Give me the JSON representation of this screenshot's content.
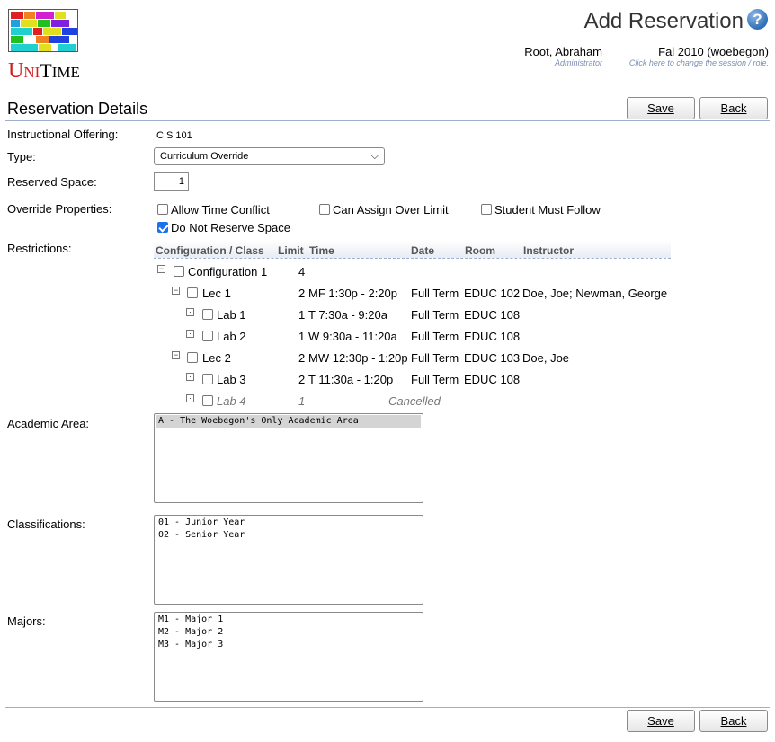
{
  "header": {
    "logo_text": "UniTime",
    "page_title": "Add Reservation",
    "help_icon": "help-icon",
    "user_name": "Root, Abraham",
    "user_role": "Administrator",
    "session_name": "Fal 2010 (woebegon)",
    "session_hint": "Click here to change the session / role."
  },
  "section": {
    "title": "Reservation Details",
    "save_label": "Save",
    "back_label": "Back"
  },
  "form": {
    "offering_label": "Instructional Offering:",
    "offering_value": "C S 101",
    "type_label": "Type:",
    "type_value": "Curriculum Override",
    "reserved_label": "Reserved Space:",
    "reserved_value": "1",
    "override_label": "Override Properties:",
    "override_options": [
      {
        "label": "Allow Time Conflict",
        "checked": false
      },
      {
        "label": "Can Assign Over Limit",
        "checked": false
      },
      {
        "label": "Student Must Follow",
        "checked": false
      },
      {
        "label": "Do Not Reserve Space",
        "checked": true
      }
    ],
    "restrictions_label": "Restrictions:",
    "academic_area_label": "Academic Area:",
    "classifications_label": "Classifications:",
    "majors_label": "Majors:"
  },
  "restrictions": {
    "columns": [
      "Configuration / Class",
      "Limit",
      "Time",
      "Date",
      "Room",
      "Instructor"
    ],
    "rows": [
      {
        "name": "Configuration 1",
        "limit": "4",
        "time": "",
        "date": "",
        "room": "",
        "instructor": ""
      },
      {
        "name": "Lec 1",
        "limit": "2",
        "time": "MF 1:30p - 2:20p",
        "date": "Full Term",
        "room": "EDUC 102",
        "instructor": "Doe, Joe; Newman, George"
      },
      {
        "name": "Lab 1",
        "limit": "1",
        "time": "T 7:30a - 9:20a",
        "date": "Full Term",
        "room": "EDUC 108",
        "instructor": ""
      },
      {
        "name": "Lab 2",
        "limit": "1",
        "time": "W 9:30a - 11:20a",
        "date": "Full Term",
        "room": "EDUC 108",
        "instructor": ""
      },
      {
        "name": "Lec 2",
        "limit": "2",
        "time": "MW 12:30p - 1:20p",
        "date": "Full Term",
        "room": "EDUC 103",
        "instructor": "Doe, Joe"
      },
      {
        "name": "Lab 3",
        "limit": "2",
        "time": "T 11:30a - 1:20p",
        "date": "Full Term",
        "room": "EDUC 108",
        "instructor": ""
      },
      {
        "name": "Lab 4",
        "limit": "1",
        "time": "",
        "date": "Cancelled",
        "room": "",
        "instructor": ""
      }
    ]
  },
  "academic_areas": [
    "A - The Woebegon's Only Academic Area"
  ],
  "classifications": [
    "01 - Junior Year",
    "02 - Senior Year"
  ],
  "majors": [
    "M1 - Major 1",
    "M2 - Major 2",
    "M3 - Major 3"
  ]
}
